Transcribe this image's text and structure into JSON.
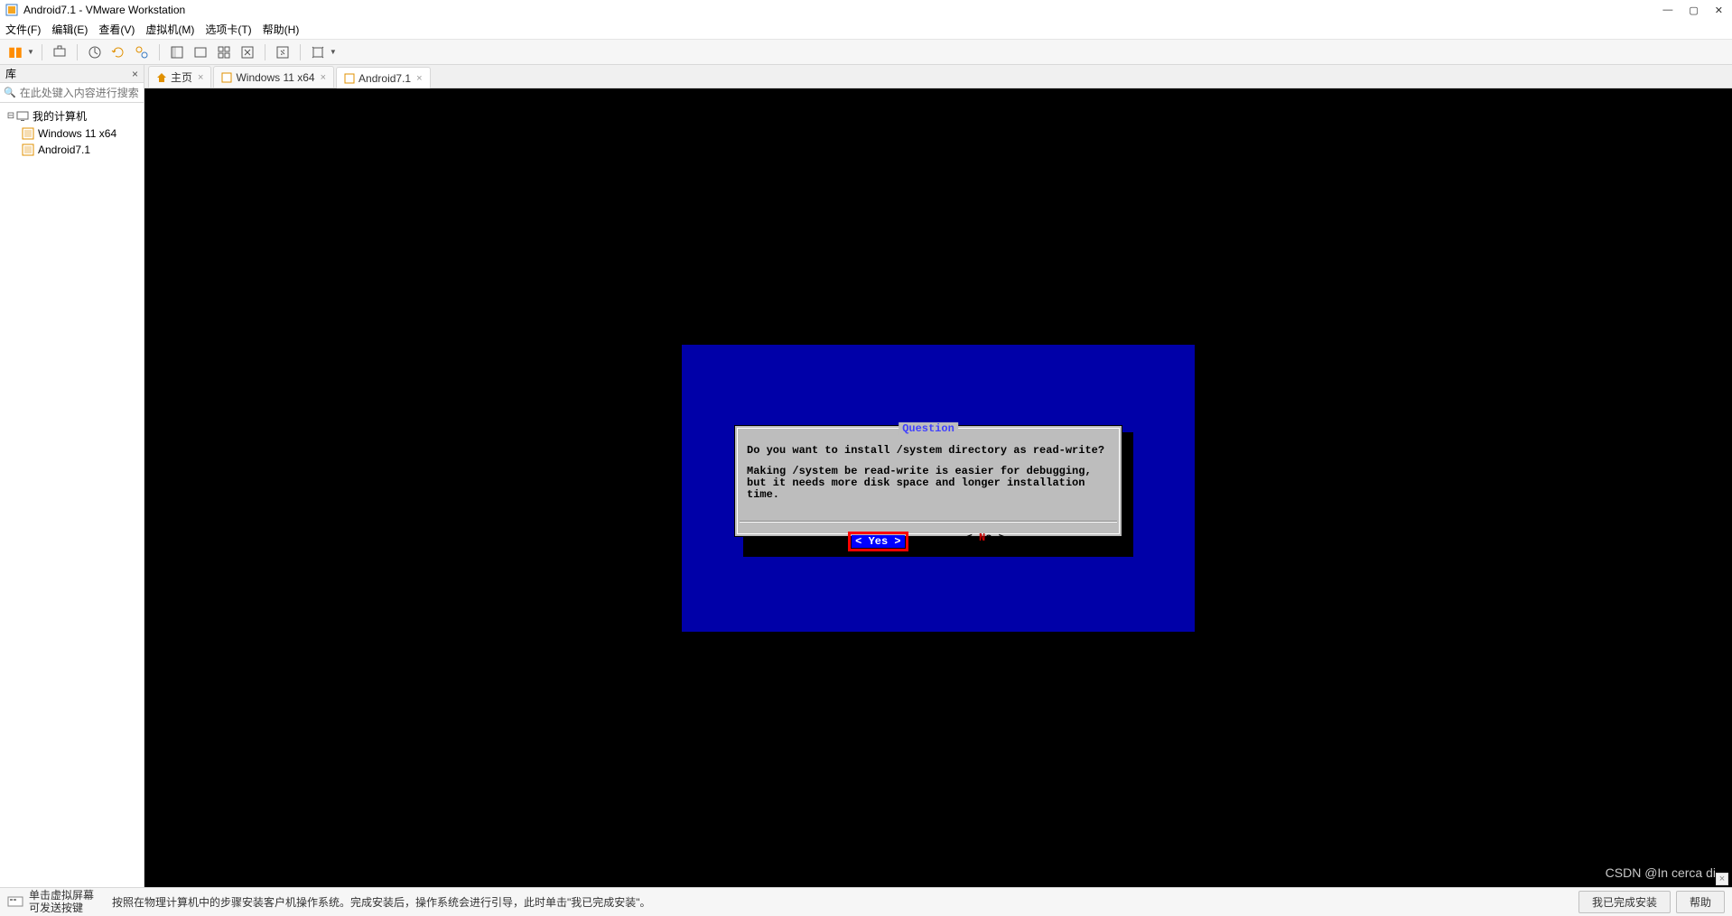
{
  "window": {
    "title": "Android7.1 - VMware Workstation",
    "min": "—",
    "max": "▢",
    "close": "✕"
  },
  "menu": {
    "file": "文件(F)",
    "edit": "编辑(E)",
    "view": "查看(V)",
    "vm": "虚拟机(M)",
    "tabs": "选项卡(T)",
    "help": "帮助(H)"
  },
  "sidebar": {
    "header": "库",
    "close": "×",
    "search_placeholder": "在此处键入内容进行搜索",
    "tree": {
      "root": "我的计算机",
      "items": [
        {
          "label": "Windows 11 x64"
        },
        {
          "label": "Android7.1"
        }
      ]
    }
  },
  "tabs": [
    {
      "label": "主页",
      "icon": "home"
    },
    {
      "label": "Windows 11 x64",
      "icon": "vm"
    },
    {
      "label": "Android7.1",
      "icon": "vm",
      "active": true
    }
  ],
  "dialog": {
    "title": "Question",
    "line1": "Do you want to install /system directory as read-write?",
    "line2": "Making /system be read-write is easier for debugging, but it needs more disk space and longer installation time.",
    "yes": "< Yes >",
    "no_prefix": "<  ",
    "no_hot": "N",
    "no_rest": "o  >"
  },
  "bottombar": {
    "hint1": "单击虚拟屏幕",
    "hint2": "可发送按键",
    "instruction": "按照在物理计算机中的步骤安装客户机操作系统。完成安装后，操作系统会进行引导，此时单击\"我已完成安装\"。",
    "done": "我已完成安装",
    "help": "帮助"
  },
  "watermark": "CSDN @In cerca di"
}
